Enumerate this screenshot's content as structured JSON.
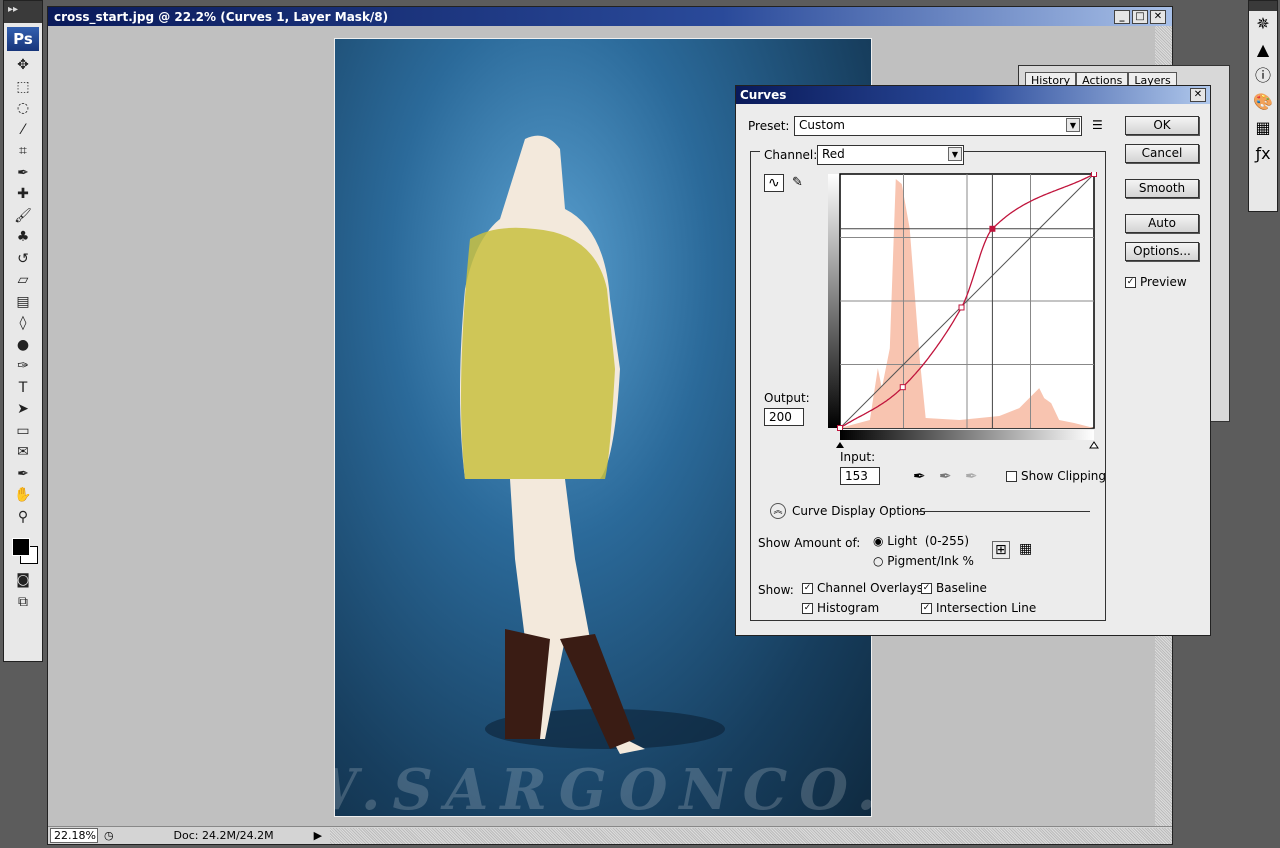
{
  "document": {
    "title": "cross_start.jpg @ 22.2% (Curves 1, Layer Mask/8)",
    "zoom": "22.18%",
    "doc_size": "Doc: 24.2M/24.2M",
    "watermark": "WWW.SARGONCO.CO"
  },
  "toolbox": {
    "logo": "Ps",
    "tools": [
      "move-icon",
      "marquee-icon",
      "lasso-icon",
      "magic-wand-icon",
      "crop-icon",
      "eyedropper-icon",
      "healing-brush-icon",
      "brush-icon",
      "clone-stamp-icon",
      "history-brush-icon",
      "eraser-icon",
      "gradient-icon",
      "blur-icon",
      "dodge-icon",
      "pen-icon",
      "type-icon",
      "path-selection-icon",
      "shape-icon",
      "notes-icon",
      "eyedropper-icon",
      "hand-icon",
      "zoom-icon"
    ]
  },
  "panel": {
    "tabs": [
      "History",
      "Actions",
      "Layers"
    ]
  },
  "curves": {
    "title": "Curves",
    "preset_label": "Preset:",
    "preset_value": "Custom",
    "channel_label": "Channel:",
    "channel_value": "Red",
    "output_label": "Output:",
    "output_value": "200",
    "input_label": "Input:",
    "input_value": "153",
    "show_clipping": "Show Clipping",
    "show_clipping_checked": false,
    "buttons": {
      "ok": "OK",
      "cancel": "Cancel",
      "smooth": "Smooth",
      "auto": "Auto",
      "options": "Options..."
    },
    "preview": "Preview",
    "preview_checked": true,
    "display_options": "Curve Display Options",
    "show_amount_label": "Show Amount of:",
    "light": "Light  (0-255)",
    "pigment": "Pigment/Ink %",
    "selected_amount": "light",
    "show_label": "Show:",
    "channel_overlays": "Channel Overlays",
    "baseline": "Baseline",
    "histogram": "Histogram",
    "intersection_line": "Intersection Line",
    "curve_color": "#c0143c",
    "histogram_color": "#f8c4b0",
    "curve_points": [
      [
        0,
        0
      ],
      [
        63,
        41
      ],
      [
        122,
        121
      ],
      [
        153,
        200
      ],
      [
        255,
        255
      ]
    ]
  }
}
